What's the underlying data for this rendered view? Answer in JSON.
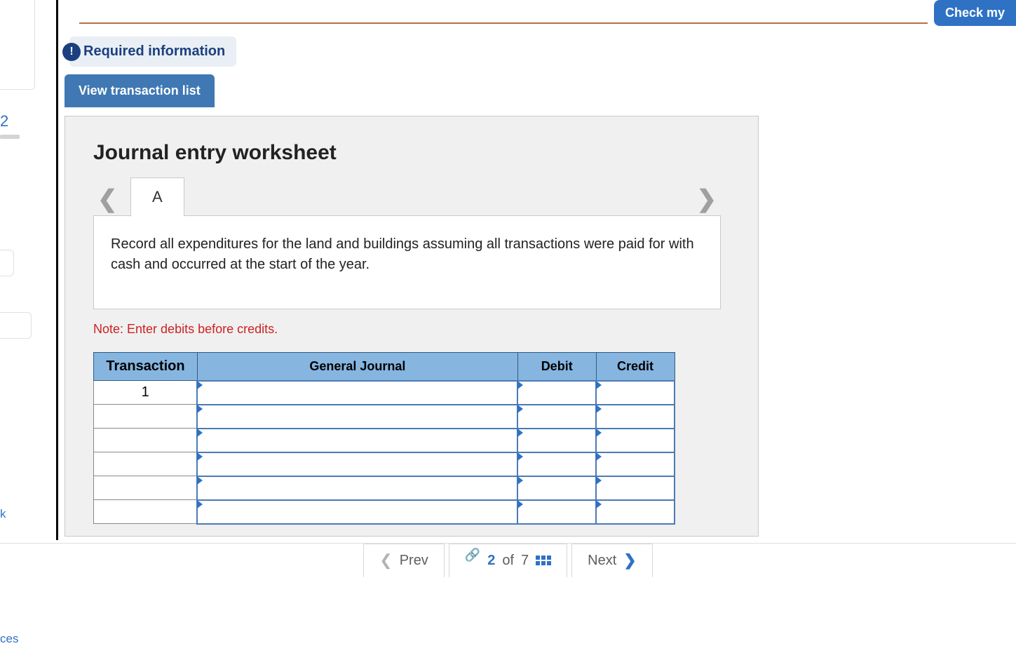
{
  "topRight": {
    "checkLabel": "Check my"
  },
  "leftSidebar": {
    "number": "2",
    "labelK": "k",
    "labelCes": "ces"
  },
  "requiredInfo": {
    "badge": "!",
    "label": "Required information"
  },
  "viewTransactionBtn": "View transaction list",
  "worksheet": {
    "title": "Journal entry worksheet",
    "tabs": [
      "A"
    ],
    "instruction": "Record all expenditures for the land and buildings assuming all transactions were paid for with cash and occurred at the start of the year.",
    "note": "Note: Enter debits before credits.",
    "tableHeaders": {
      "transaction": "Transaction",
      "generalJournal": "General Journal",
      "debit": "Debit",
      "credit": "Credit"
    },
    "rows": [
      {
        "transaction": "1",
        "generalJournal": "",
        "debit": "",
        "credit": ""
      },
      {
        "transaction": "",
        "generalJournal": "",
        "debit": "",
        "credit": ""
      },
      {
        "transaction": "",
        "generalJournal": "",
        "debit": "",
        "credit": ""
      },
      {
        "transaction": "",
        "generalJournal": "",
        "debit": "",
        "credit": ""
      },
      {
        "transaction": "",
        "generalJournal": "",
        "debit": "",
        "credit": ""
      },
      {
        "transaction": "",
        "generalJournal": "",
        "debit": "",
        "credit": ""
      }
    ]
  },
  "bottomNav": {
    "prev": "Prev",
    "current": "2",
    "ofLabel": "of",
    "total": "7",
    "next": "Next"
  }
}
